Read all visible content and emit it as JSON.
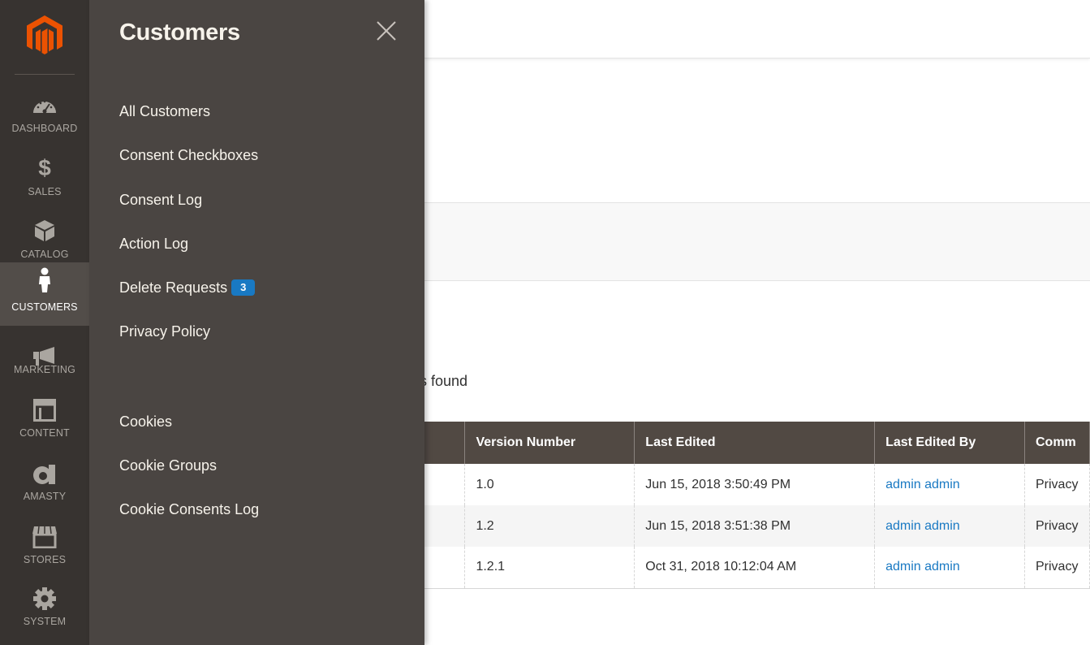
{
  "nav": {
    "items": [
      {
        "label": "DASHBOARD",
        "icon": "dashboard-icon"
      },
      {
        "label": "SALES",
        "icon": "dollar-icon"
      },
      {
        "label": "CATALOG",
        "icon": "box-icon"
      },
      {
        "label": "CUSTOMERS",
        "icon": "person-icon",
        "active": true
      },
      {
        "label": "MARKETING",
        "icon": "megaphone-icon"
      },
      {
        "label": "CONTENT",
        "icon": "layout-icon"
      },
      {
        "label": "AMASTY",
        "icon": "amasty-icon"
      },
      {
        "label": "STORES",
        "icon": "store-icon"
      },
      {
        "label": "SYSTEM",
        "icon": "gear-icon"
      }
    ]
  },
  "flyout": {
    "title": "Customers",
    "links": [
      {
        "label": "All Customers"
      },
      {
        "label": "Consent Checkboxes"
      },
      {
        "label": "Consent Log"
      },
      {
        "label": "Action Log"
      },
      {
        "label": "Delete Requests",
        "badge": "3"
      },
      {
        "label": "Privacy Policy"
      },
      {
        "label": "Cookies"
      },
      {
        "label": "Cookie Groups"
      },
      {
        "label": "Cookie Consents Log"
      }
    ]
  },
  "main": {
    "records_found_fragment": "s found"
  },
  "grid": {
    "columns": [
      "",
      "Version Number",
      "Last Edited",
      "Last Edited By",
      "Comm"
    ],
    "rows": [
      {
        "version": "1.0",
        "last_edited": "Jun 15, 2018 3:50:49 PM",
        "last_edited_by": "admin admin",
        "comment": "Privacy"
      },
      {
        "version": "1.2",
        "last_edited": "Jun 15, 2018 3:51:38 PM",
        "last_edited_by": "admin admin",
        "comment": "Privacy"
      },
      {
        "version": "1.2.1",
        "last_edited": "Oct 31, 2018 10:12:04 AM",
        "last_edited_by": "admin admin",
        "comment": "Privacy"
      }
    ]
  },
  "colors": {
    "nav_bg": "#373330",
    "flyout_bg": "#4a4542",
    "accent": "#eb5202",
    "link": "#1979c3",
    "table_header": "#514943"
  }
}
